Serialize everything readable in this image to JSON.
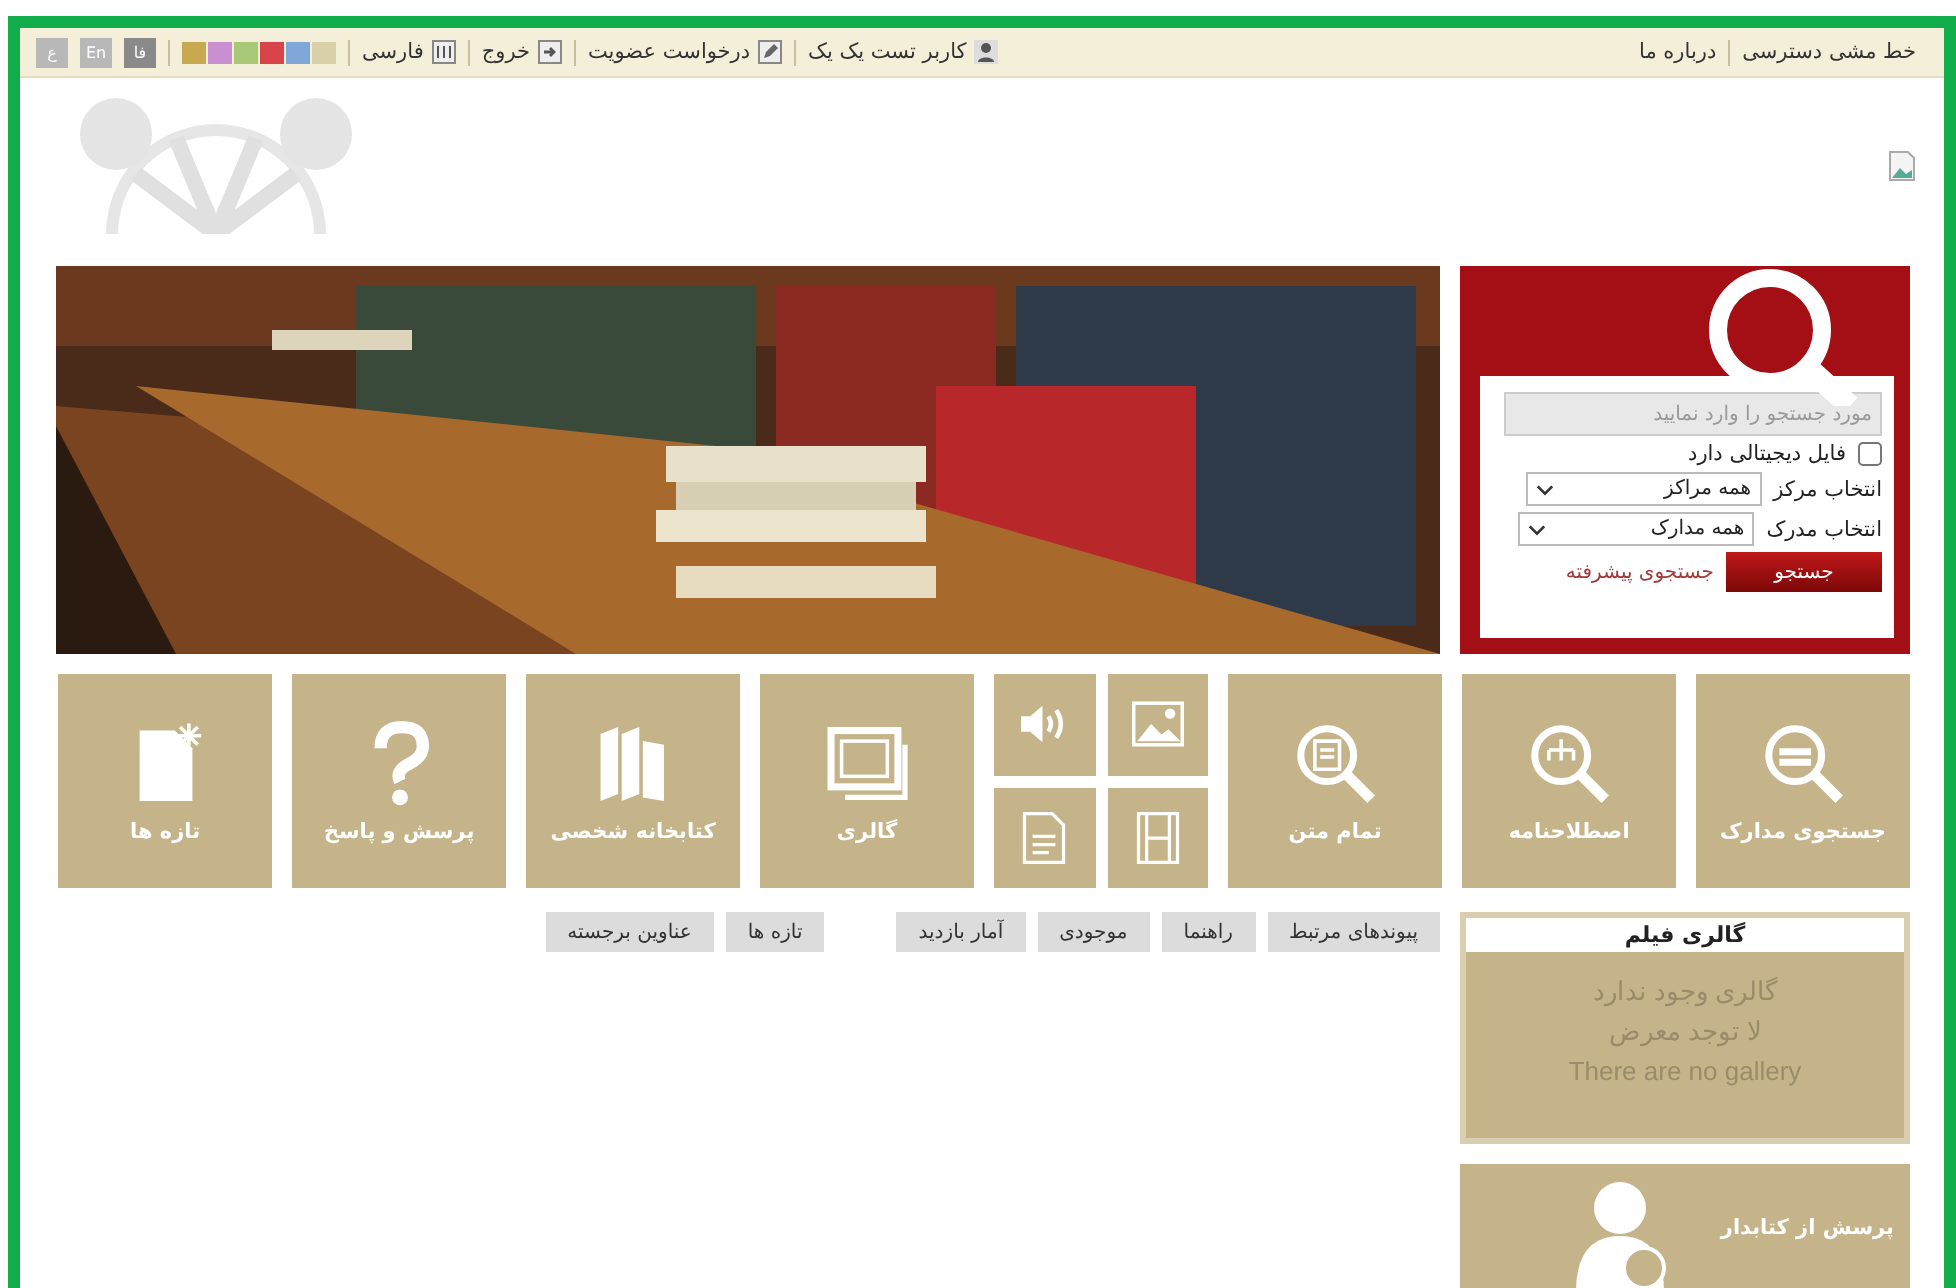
{
  "top_bar": {
    "right_links": [
      "خط مشی دسترسی",
      "درباره ما"
    ],
    "user_items": [
      {
        "kind": "user",
        "label": "کاربر تست یک یک"
      },
      {
        "kind": "edit",
        "label": "درخواست عضویت"
      },
      {
        "kind": "exit",
        "label": "خروج"
      },
      {
        "kind": "grid",
        "label": "فارسی"
      }
    ],
    "swatches": [
      {
        "color": "#d9cfa8"
      },
      {
        "color": "#7fa7d8"
      },
      {
        "color": "#d9444b"
      },
      {
        "color": "#a8c878"
      },
      {
        "color": "#c890d0"
      },
      {
        "color": "#c8a850"
      }
    ],
    "languages": [
      {
        "label": "فا",
        "selected": true
      },
      {
        "label": "En",
        "selected": false
      },
      {
        "label": "ع",
        "selected": false
      }
    ]
  },
  "search": {
    "placeholder": "مورد جستجو را وارد نمایید",
    "digital_file": {
      "label": "فایل دیجیتالی دارد",
      "checked": false
    },
    "selects": [
      {
        "label": "انتخاب مرکز",
        "value": "همه مراکز"
      },
      {
        "label": "انتخاب مدرک",
        "value": "همه مدارک"
      }
    ],
    "button": "جستجو",
    "advanced_link": "جستجوی پیشرفته"
  },
  "tiles": [
    {
      "kind": "search-docs",
      "label": "جستجوی مدارک"
    },
    {
      "kind": "thesaurus",
      "label": "اصطلاحنامه"
    },
    {
      "kind": "fulltext",
      "label": "تمام متن"
    },
    {
      "kind": "media"
    },
    {
      "kind": "gallery",
      "label": "گالری"
    },
    {
      "kind": "books",
      "label": "کتابخانه شخصی"
    },
    {
      "kind": "question",
      "label": "پرسش و پاسخ"
    },
    {
      "kind": "news",
      "label": "تازه ها"
    }
  ],
  "link_groups": [
    {
      "buttons": [
        "پیوندهای مرتبط",
        "راهنما",
        "موجودی",
        "آمار بازدید"
      ]
    },
    {
      "buttons": [
        "تازه ها",
        "عناوین برجسته"
      ]
    }
  ],
  "film_gallery": {
    "title": "گالری فیلم",
    "messages": [
      "گالری وجود ندارد",
      "لا توجد معرض",
      "There are no gallery"
    ]
  },
  "ask_librarian": {
    "label": "پرسش از کتابدار"
  }
}
